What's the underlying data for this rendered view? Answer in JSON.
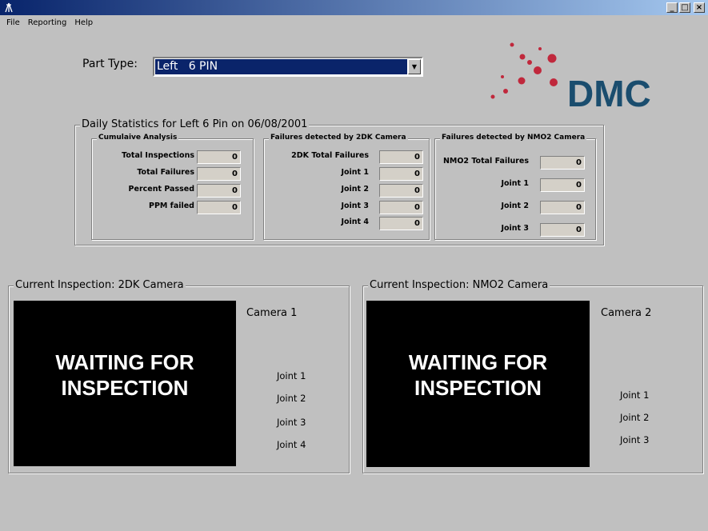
{
  "window": {
    "app_icon": "tripod-icon"
  },
  "menu": [
    "File",
    "Reporting",
    "Help"
  ],
  "part_type": {
    "label": "Part Type:",
    "value": "Left   6 PIN"
  },
  "logo": {
    "text": "DMC"
  },
  "daily": {
    "title": "Daily Statistics for Left 6 Pin on 06/08/2001",
    "cumulative": {
      "title": "Cumulaive Analysis",
      "rows": [
        {
          "label": "Total Inspections",
          "value": "0"
        },
        {
          "label": "Total Failures",
          "value": "0"
        },
        {
          "label": "Percent Passed",
          "value": "0"
        },
        {
          "label": "PPM failed",
          "value": "0"
        }
      ]
    },
    "twodk": {
      "title": "Failures detected by 2DK Camera",
      "rows": [
        {
          "label": "2DK Total Failures",
          "value": "0"
        },
        {
          "label": "Joint 1",
          "value": "0"
        },
        {
          "label": "Joint 2",
          "value": "0"
        },
        {
          "label": "Joint 3",
          "value": "0"
        },
        {
          "label": "Joint 4",
          "value": "0"
        }
      ]
    },
    "nmo2": {
      "title": "Failures detected by NMO2 Camera",
      "rows": [
        {
          "label": "NMO2 Total Failures",
          "value": "0"
        },
        {
          "label": "Joint 1",
          "value": "0"
        },
        {
          "label": "Joint 2",
          "value": "0"
        },
        {
          "label": "Joint 3",
          "value": "0"
        }
      ]
    }
  },
  "current_2dk": {
    "title": "Current Inspection: 2DK Camera",
    "screen_line1": "WAITING   FOR",
    "screen_line2": "INSPECTION",
    "camera": "Camera 1",
    "joints": [
      "Joint 1",
      "Joint 2",
      "Joint 3",
      "Joint 4"
    ]
  },
  "current_nmo2": {
    "title": "Current Inspection: NMO2 Camera",
    "screen_line1": "WAITING   FOR",
    "screen_line2": "INSPECTION",
    "camera": "Camera 2",
    "joints": [
      "Joint 1",
      "Joint 2",
      "Joint 3"
    ]
  },
  "colors": {
    "title_start": "#08246b",
    "title_end": "#a5c8ef",
    "logo_blue": "#1a4d6e",
    "logo_dots": "#c0283c",
    "selection": "#0a246a"
  }
}
